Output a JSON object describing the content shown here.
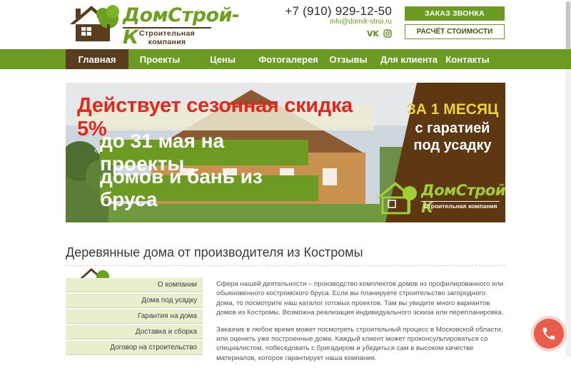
{
  "header": {
    "logo_name": "ДомСтрой-К",
    "logo_subtitle": "Строительная компания",
    "phone": "+7 (910) 929-12-50",
    "email": "info@domik-stroi.ru",
    "social": [
      "vk-icon",
      "instagram-icon"
    ],
    "call_button": "ЗАКАЗ ЗВОНКА",
    "calc_button": "РАСЧЁТ СТОИМОСТИ"
  },
  "nav": {
    "items": [
      "Главная",
      "Проекты",
      "Цены",
      "Фотогалерея",
      "Отзывы",
      "Для клиента",
      "Контакты"
    ],
    "active_index": 0
  },
  "banner": {
    "line1": "Действует сезонная скидка 5%",
    "line2": "до 31 мая на проекты",
    "line3": "домов и бань из бруса",
    "right_line1": "ЗА 1 МЕСЯЦ",
    "right_line2": "с гаратией под усадку",
    "logo_name": "ДомСтрой-К",
    "logo_subtitle": "Строительная компания"
  },
  "page": {
    "title": "Деревянные дома от производителя из Костромы"
  },
  "sidebar": {
    "items": [
      "О компании",
      "Дома под усадку",
      "Гарантия на дома",
      "Доставка и сборка",
      "Договор на строительство"
    ]
  },
  "content": {
    "p1": "Сфера нашей деятельности – производство комплектов домов из профилированного или обыкновенного костромского бруса. Если вы планируете строительство загородного дома, то посмотрите наш каталог готовых проектов. Там вы увидите много вариантов домов из Костромы. Возможна реализация индивидуального эскиза или перепланировка.",
    "p2": "Заказчик в любое время может посмотреть строительный процесс в Московской области, или оценить уже построенные дома. Каждый клиент может проконсультироваться со специалистом, побеседовать с бригадиром и убедиться сам в высоком качестве материалов, которое гарантирует наша компания."
  },
  "colors": {
    "brand_green": "#6b9b22",
    "brand_brown": "#5a3c1e",
    "call_red": "#e95b4b"
  }
}
